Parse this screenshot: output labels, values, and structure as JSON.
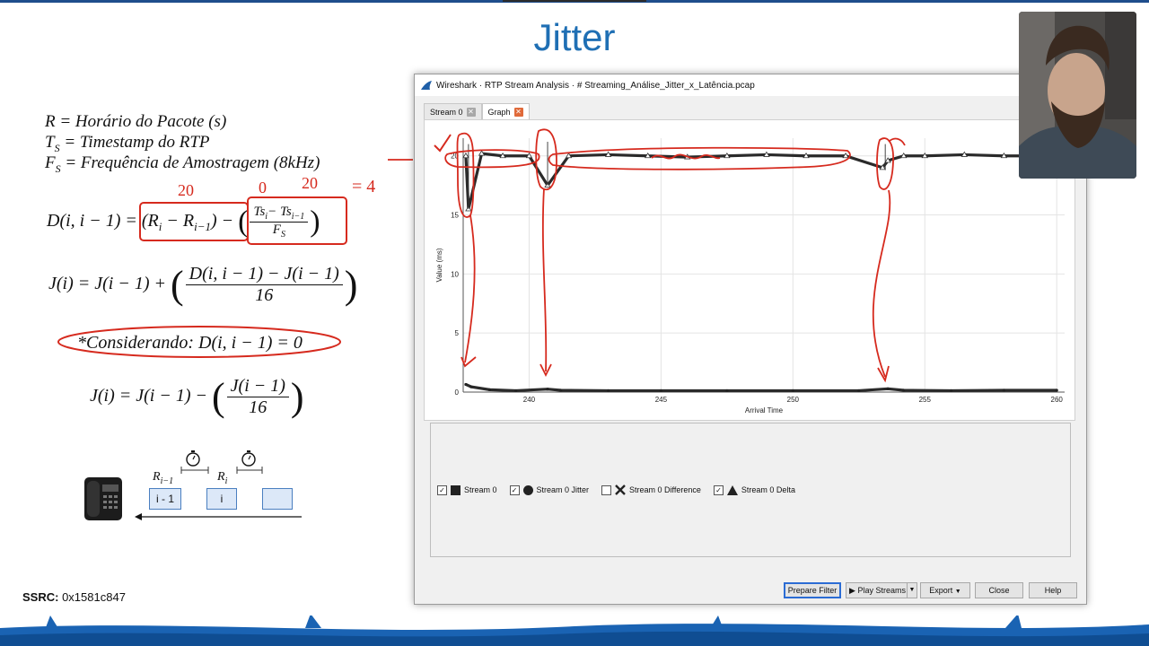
{
  "slide": {
    "title": "Jitter",
    "ssrc_label": "SSRC:",
    "ssrc_value": "0x1581c847"
  },
  "definitions": {
    "r": "R = Horário do Pacote (s)",
    "ts": "T",
    "ts_sub": "S",
    "ts_rest": " = Timestamp do RTP",
    "fs": "F",
    "fs_sub": "S",
    "fs_rest": " = Frequência de Amostragem (8kHz)"
  },
  "formulas": {
    "d_lhs": "D(i, i − 1) = ",
    "d_r": "(R",
    "d_r_sub": "i",
    "d_minus": "  −  R",
    "d_rprev_sub": "i−1",
    "d_close": ") − ",
    "d_num": "Ts",
    "d_num_sub1": "i",
    "d_num_mid": "− Ts",
    "d_num_sub2": "i−1",
    "d_den": "F",
    "d_den_sub": "S",
    "j_lhs": "J(i) = J(i − 1) + ",
    "j_num": "D(i, i − 1) − J(i − 1)",
    "j_den": "16",
    "considerando": "*Considerando:  D(i, i − 1) = 0",
    "j2_lhs": "J(i) = J(i − 1) − ",
    "j2_num": "J(i  − 1)",
    "j2_den": "16"
  },
  "annotations": {
    "a1": "20",
    "a2": "0",
    "a3": "20",
    "a4": "= 4"
  },
  "diagram": {
    "r_prev": "R",
    "r_prev_sub": "i−1",
    "r_cur": "R",
    "r_cur_sub": "i",
    "pkt_prev": "i - 1",
    "pkt_cur": "i",
    "pkt_next": ""
  },
  "window": {
    "title": "Wireshark · RTP Stream Analysis · # Streaming_Análise_Jitter_x_Latência.pcap",
    "tabs": [
      {
        "label": "Stream 0",
        "active": false
      },
      {
        "label": "Graph",
        "active": true
      }
    ],
    "legend": [
      {
        "checked": true,
        "icon": "square",
        "label": "Stream 0"
      },
      {
        "checked": true,
        "icon": "circle",
        "label": "Stream 0 Jitter"
      },
      {
        "checked": false,
        "icon": "cross",
        "label": "Stream 0 Difference"
      },
      {
        "checked": true,
        "icon": "triangle",
        "label": "Stream 0 Delta"
      }
    ],
    "buttons": {
      "prepare_filter": "Prepare Filter",
      "play_streams": "Play Streams",
      "export": "Export",
      "close": "Close",
      "help": "Help"
    }
  },
  "chart_data": {
    "type": "line",
    "xlabel": "Arrival Time",
    "ylabel": "Value (ms)",
    "xlim": [
      237.5,
      260.3
    ],
    "ylim": [
      0,
      21.5
    ],
    "x_ticks": [
      240,
      245,
      250,
      255,
      260
    ],
    "y_ticks": [
      0,
      5,
      10,
      15,
      20
    ],
    "grid": true,
    "series": [
      {
        "name": "Stream 0 Delta",
        "x": [
          237.6,
          237.7,
          238.2,
          239.0,
          240.0,
          240.7,
          241.5,
          243.0,
          244.5,
          246.0,
          247.5,
          249.0,
          250.5,
          252.0,
          253.4,
          253.6,
          254.2,
          255.0,
          256.5,
          258.0,
          259.0,
          260.0
        ],
        "values": [
          20.0,
          15.5,
          20.2,
          20.0,
          20.0,
          17.5,
          20.0,
          20.1,
          20.0,
          19.9,
          20.0,
          20.1,
          20.0,
          20.0,
          19.0,
          19.6,
          20.0,
          20.0,
          20.1,
          20.0,
          20.0,
          20.0
        ]
      },
      {
        "name": "Stream 0 Jitter",
        "x": [
          237.6,
          237.8,
          238.5,
          239.5,
          240.7,
          241.2,
          243.0,
          245.0,
          247.5,
          250.0,
          252.5,
          253.6,
          254.2,
          256.0,
          258.0,
          260.0
        ],
        "values": [
          0.65,
          0.45,
          0.2,
          0.12,
          0.25,
          0.15,
          0.12,
          0.12,
          0.12,
          0.12,
          0.12,
          0.28,
          0.15,
          0.12,
          0.15,
          0.15
        ]
      }
    ]
  }
}
